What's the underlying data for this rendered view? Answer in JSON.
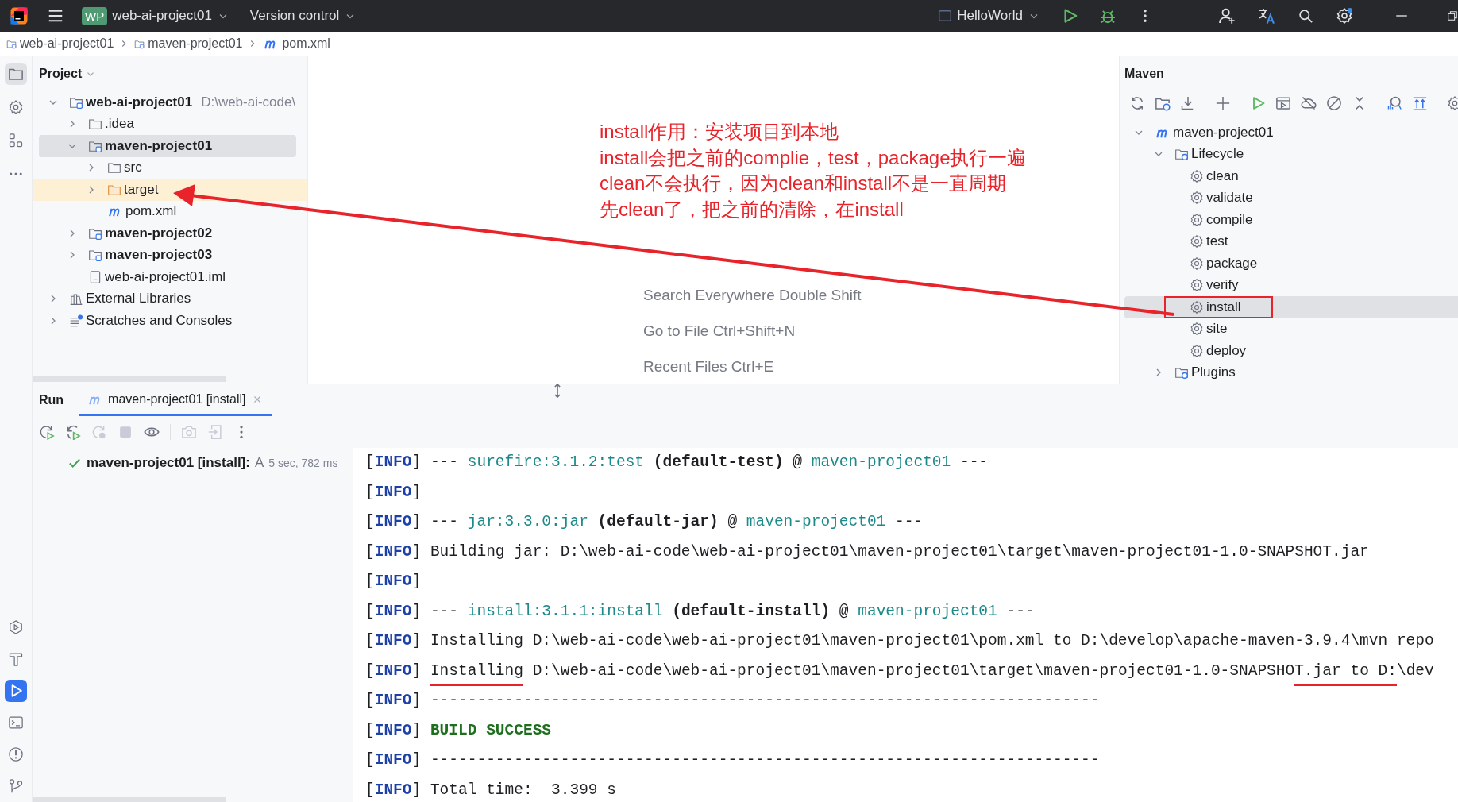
{
  "title_bar": {
    "project_badge": "WP",
    "project": "web-ai-project01",
    "vcs": "Version control",
    "run_config": "HelloWorld"
  },
  "breadcrumbs": [
    {
      "label": "web-ai-project01",
      "kind": "module"
    },
    {
      "label": "maven-project01",
      "kind": "module"
    },
    {
      "label": "pom.xml",
      "kind": "maven"
    }
  ],
  "project_panel": {
    "title": "Project",
    "tree": [
      {
        "label": "web-ai-project01",
        "path": "D:\\web-ai-code\\",
        "kind": "module",
        "expanded": true,
        "selected": false,
        "highlighted": false,
        "children": [
          {
            "label": ".idea",
            "kind": "folder",
            "expanded": false,
            "selected": false,
            "highlighted": false
          },
          {
            "label": "maven-project01",
            "kind": "module",
            "expanded": true,
            "selected": true,
            "highlighted": false,
            "children": [
              {
                "label": "src",
                "kind": "folder",
                "expanded": false,
                "selected": false,
                "highlighted": false
              },
              {
                "label": "target",
                "kind": "excluded-folder",
                "expanded": false,
                "selected": false,
                "highlighted": true
              },
              {
                "label": "pom.xml",
                "kind": "maven",
                "selected": false,
                "highlighted": false
              }
            ]
          },
          {
            "label": "maven-project02",
            "kind": "module",
            "expanded": false,
            "selected": false,
            "highlighted": false
          },
          {
            "label": "maven-project03",
            "kind": "module",
            "expanded": false,
            "selected": false,
            "highlighted": false
          },
          {
            "label": "web-ai-project01.iml",
            "kind": "file",
            "selected": false,
            "highlighted": false
          }
        ]
      },
      {
        "label": "External Libraries",
        "kind": "libraries",
        "expanded": false,
        "selected": false,
        "highlighted": false
      },
      {
        "label": "Scratches and Consoles",
        "kind": "scratches",
        "expanded": false,
        "selected": false,
        "highlighted": false
      }
    ]
  },
  "editor_hints": [
    "Search Everywhere Double Shift",
    "Go to File Ctrl+Shift+N",
    "Recent Files Ctrl+E"
  ],
  "annotation": {
    "lines": [
      "install作用：安装项目到本地",
      "install会把之前的complie，test，package执行一遍",
      "clean不会执行，因为clean和install不是一直周期",
      "先clean了，把之前的清除，在install"
    ]
  },
  "maven_panel": {
    "title": "Maven",
    "tree": [
      {
        "label": "maven-project01",
        "kind": "maven",
        "expanded": true,
        "selected": false,
        "boxed": false,
        "children": [
          {
            "label": "Lifecycle",
            "kind": "lifecycle",
            "expanded": true,
            "selected": false,
            "boxed": false,
            "children": [
              {
                "label": "clean",
                "kind": "goal",
                "selected": false,
                "boxed": false
              },
              {
                "label": "validate",
                "kind": "goal",
                "selected": false,
                "boxed": false
              },
              {
                "label": "compile",
                "kind": "goal",
                "selected": false,
                "boxed": false
              },
              {
                "label": "test",
                "kind": "goal",
                "selected": false,
                "boxed": false
              },
              {
                "label": "package",
                "kind": "goal",
                "selected": false,
                "boxed": false
              },
              {
                "label": "verify",
                "kind": "goal",
                "selected": false,
                "boxed": false
              },
              {
                "label": "install",
                "kind": "goal",
                "selected": true,
                "boxed": true
              },
              {
                "label": "site",
                "kind": "goal",
                "selected": false,
                "boxed": false
              },
              {
                "label": "deploy",
                "kind": "goal",
                "selected": false,
                "boxed": false
              }
            ]
          },
          {
            "label": "Plugins",
            "kind": "lifecycle",
            "expanded": false,
            "selected": false,
            "boxed": false
          }
        ]
      }
    ]
  },
  "run_panel": {
    "title": "Run",
    "tabs": [
      {
        "label": "maven-project01 [install]",
        "selected": true
      }
    ],
    "tree": [
      {
        "label": "maven-project01 [install]:",
        "detail": "A",
        "time": "5 sec, 782 ms",
        "succeeded": true
      }
    ],
    "console": [
      {
        "tag": "[**INFO**] ",
        "segments": [
          {
            "text": "--- ",
            "kind": "plain"
          },
          {
            "text": "surefire:3.1.2:test",
            "kind": "link"
          },
          {
            "text": " (default-test)",
            "kind": "bold"
          },
          {
            "text": " @ ",
            "kind": "plain"
          },
          {
            "text": "maven-project01",
            "kind": "link"
          },
          {
            "text": " ---",
            "kind": "plain"
          }
        ]
      },
      {
        "tag": "[**INFO**]"
      },
      {
        "tag": "[**INFO**] ",
        "segments": [
          {
            "text": "--- ",
            "kind": "plain"
          },
          {
            "text": "jar:3.3.0:jar",
            "kind": "link"
          },
          {
            "text": " (default-jar)",
            "kind": "bold"
          },
          {
            "text": " @ ",
            "kind": "plain"
          },
          {
            "text": "maven-project01",
            "kind": "link"
          },
          {
            "text": " ---",
            "kind": "plain"
          }
        ]
      },
      {
        "tag": "[**INFO**] ",
        "segments": [
          {
            "text": "Building jar: D:\\web-ai-code\\web-ai-project01\\maven-project01\\target\\maven-project01-1.0-SNAPSHOT.jar",
            "kind": "plain"
          }
        ]
      },
      {
        "tag": "[**INFO**]"
      },
      {
        "tag": "[**INFO**] ",
        "segments": [
          {
            "text": "--- ",
            "kind": "plain"
          },
          {
            "text": "install:3.1.1:install",
            "kind": "link"
          },
          {
            "text": " (default-install)",
            "kind": "bold"
          },
          {
            "text": " @ ",
            "kind": "plain"
          },
          {
            "text": "maven-project01",
            "kind": "link"
          },
          {
            "text": " ---",
            "kind": "plain"
          }
        ]
      },
      {
        "tag": "[**INFO**] ",
        "segments": [
          {
            "text": "Installing D:\\web-ai-code\\web-ai-project01\\maven-project01\\pom.xml to D:\\develop\\apache-maven-3.9.4\\mvn_repo",
            "kind": "plain"
          }
        ]
      },
      {
        "tag": "[**INFO**] ",
        "segments": [
          {
            "text": "Installing",
            "kind": "plain",
            "underlined": true
          },
          {
            "text": " D:\\web-ai-code\\web-ai-project01\\maven-project01\\target\\maven-project01-1.0-SNAPSHO",
            "kind": "plain",
            "underlined": false
          },
          {
            "text": "T.jar to D:",
            "kind": "plain",
            "underlined": true
          },
          {
            "text": "\\dev",
            "kind": "plain",
            "underlined": false
          }
        ]
      },
      {
        "tag": "[**INFO**] ",
        "segments": [
          {
            "text": "------------------------------------------------------------------------",
            "kind": "plain"
          }
        ]
      },
      {
        "tag": "[**INFO**] ",
        "segments": [
          {
            "text": "BUILD SUCCESS",
            "kind": "success"
          }
        ]
      },
      {
        "tag": "[**INFO**] ",
        "segments": [
          {
            "text": "------------------------------------------------------------------------",
            "kind": "plain"
          }
        ]
      },
      {
        "tag": "[**INFO**] ",
        "segments": [
          {
            "text": "Total time:  3.399 s",
            "kind": "plain"
          }
        ]
      }
    ]
  }
}
